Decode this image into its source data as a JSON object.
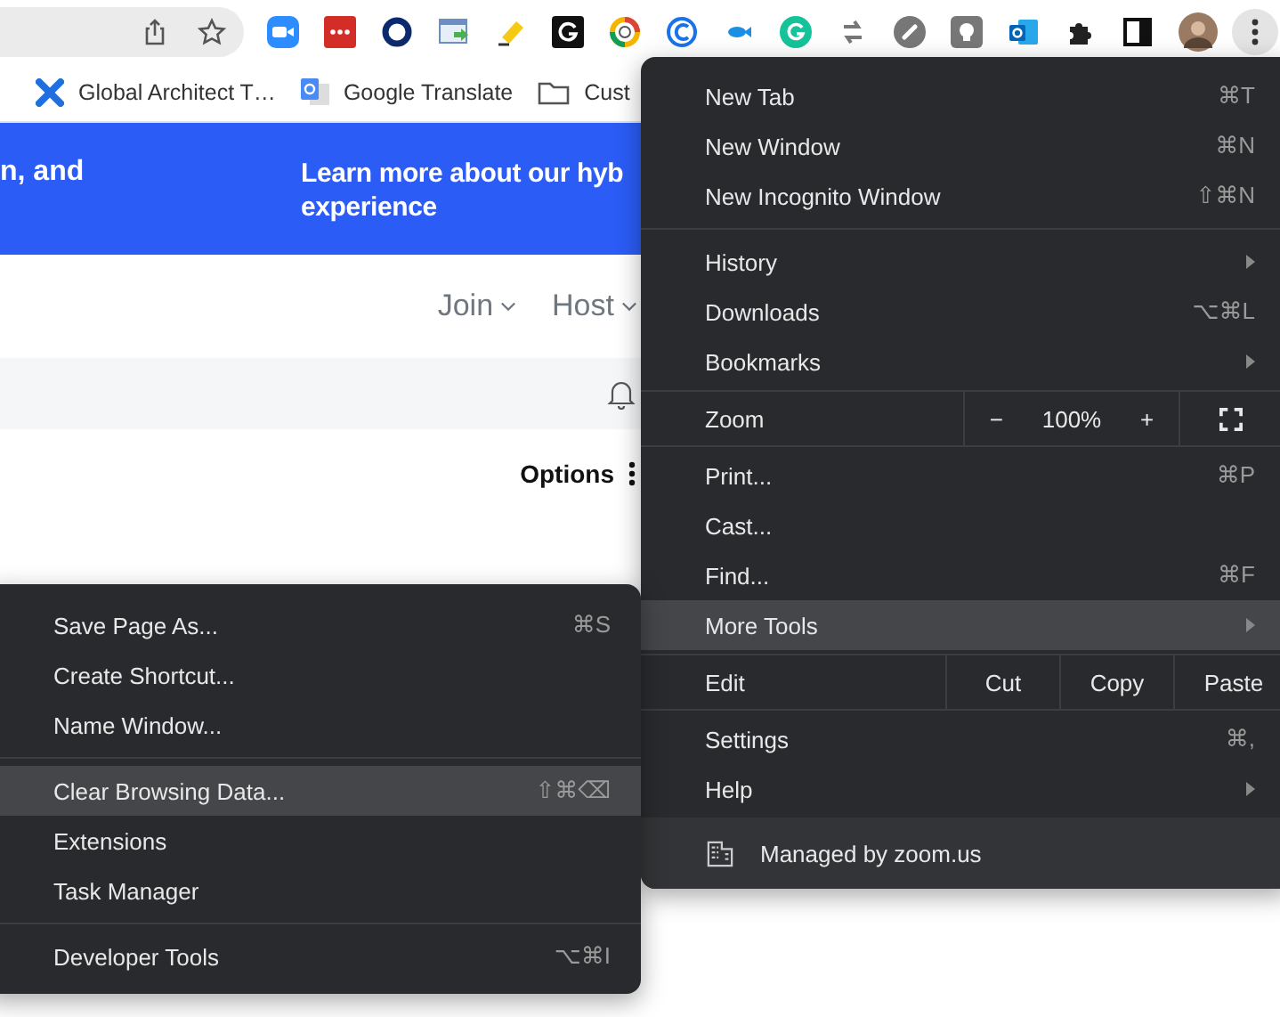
{
  "bookmarks": [
    {
      "label": "Global Architect T…"
    },
    {
      "label": "Google Translate"
    },
    {
      "label": "Cust"
    }
  ],
  "banner": {
    "left_text": "n, and",
    "right_lines": [
      "Learn more about our hyb",
      "experience"
    ]
  },
  "nav": [
    {
      "label": "Join"
    },
    {
      "label": "Host"
    }
  ],
  "options": {
    "label": "Options"
  },
  "menu": {
    "items": [
      {
        "kind": "item",
        "label": "New Tab",
        "shortcut": "⌘T",
        "submenu": false,
        "selected": false
      },
      {
        "kind": "item",
        "label": "New Window",
        "shortcut": "⌘N",
        "submenu": false,
        "selected": false
      },
      {
        "kind": "item",
        "label": "New Incognito Window",
        "shortcut": "⇧⌘N",
        "submenu": false,
        "selected": false
      },
      {
        "kind": "separator"
      },
      {
        "kind": "item",
        "label": "History",
        "submenu": true,
        "selected": false
      },
      {
        "kind": "item",
        "label": "Downloads",
        "shortcut": "⌥⌘L",
        "submenu": false,
        "selected": false
      },
      {
        "kind": "item",
        "label": "Bookmarks",
        "submenu": true,
        "selected": false
      },
      {
        "kind": "zoom",
        "label": "Zoom",
        "minus": "−",
        "value": "100%",
        "plus": "+"
      },
      {
        "kind": "item",
        "label": "Print...",
        "shortcut": "⌘P",
        "submenu": false,
        "selected": false
      },
      {
        "kind": "item",
        "label": "Cast...",
        "submenu": false,
        "selected": false
      },
      {
        "kind": "item",
        "label": "Find...",
        "shortcut": "⌘F",
        "submenu": false,
        "selected": false
      },
      {
        "kind": "item",
        "label": "More Tools",
        "submenu": true,
        "selected": true
      },
      {
        "kind": "edit",
        "label": "Edit",
        "actions": [
          "Cut",
          "Copy",
          "Paste"
        ]
      },
      {
        "kind": "item",
        "label": "Settings",
        "shortcut": "⌘,",
        "submenu": false,
        "selected": false
      },
      {
        "kind": "item",
        "label": "Help",
        "submenu": true,
        "selected": false
      }
    ],
    "footer": "Managed by zoom.us"
  },
  "submenu": {
    "items": [
      {
        "kind": "item",
        "label": "Save Page As...",
        "shortcut": "⌘S",
        "selected": false
      },
      {
        "kind": "item",
        "label": "Create Shortcut...",
        "selected": false
      },
      {
        "kind": "item",
        "label": "Name Window...",
        "selected": false
      },
      {
        "kind": "separator"
      },
      {
        "kind": "item",
        "label": "Clear Browsing Data...",
        "shortcut": "⇧⌘⌫",
        "selected": true
      },
      {
        "kind": "item",
        "label": "Extensions",
        "selected": false
      },
      {
        "kind": "item",
        "label": "Task Manager",
        "selected": false
      },
      {
        "kind": "separator"
      },
      {
        "kind": "item",
        "label": "Developer Tools",
        "shortcut": "⌥⌘I",
        "selected": false
      }
    ]
  }
}
